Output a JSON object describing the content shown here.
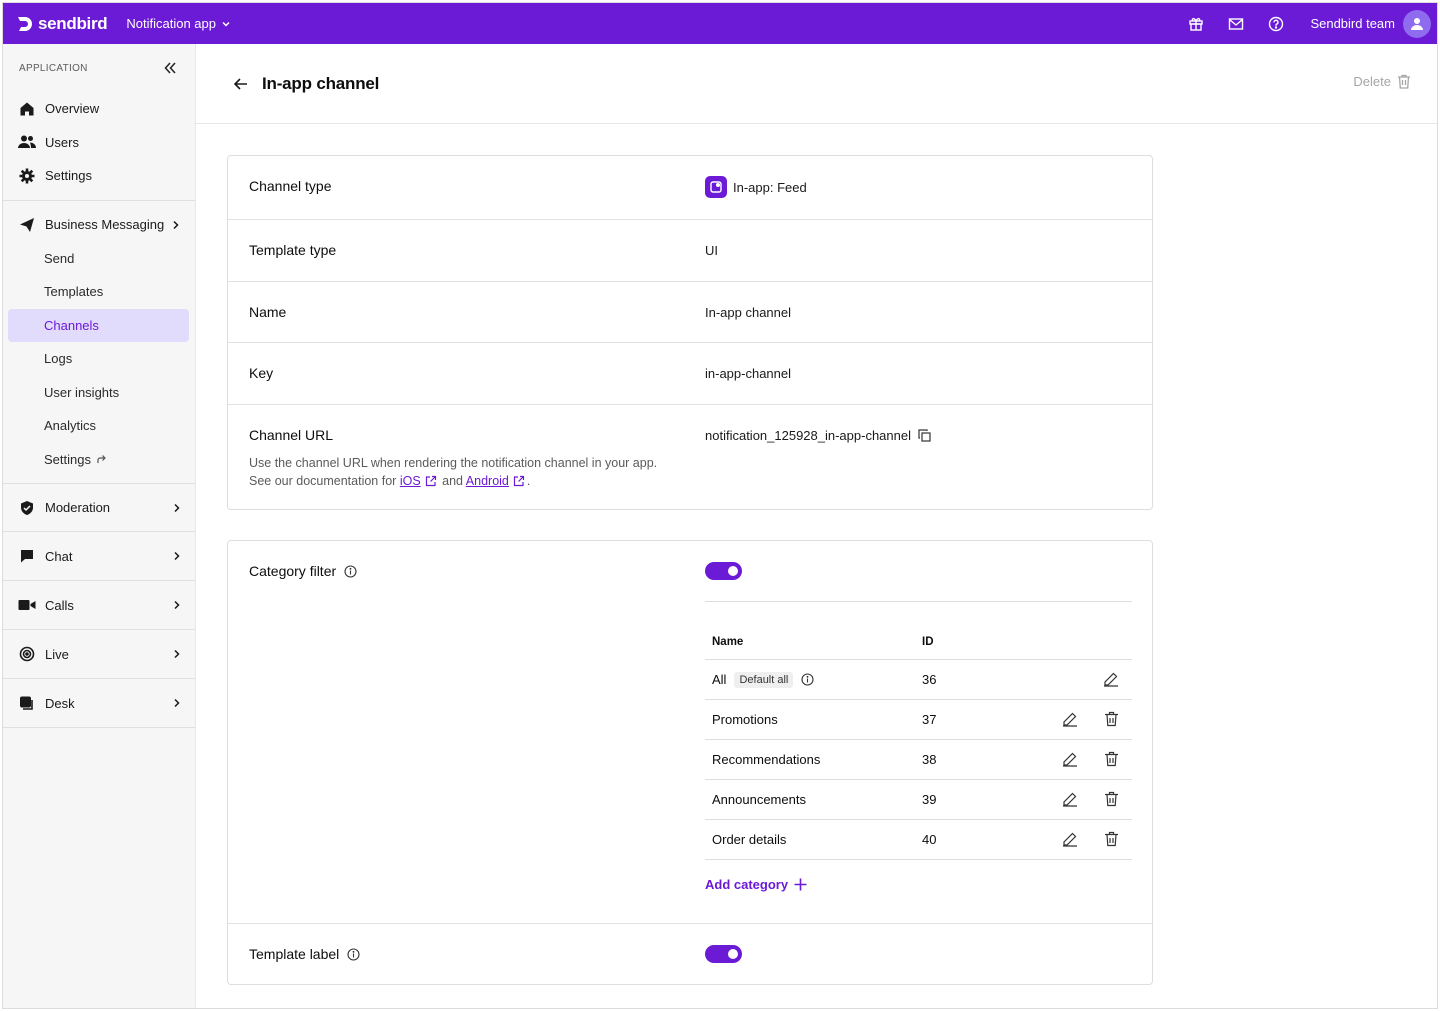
{
  "topbar": {
    "logo": "sendbird",
    "app_name": "Notification app",
    "team_name": "Sendbird team",
    "icons": [
      "gift-icon",
      "mail-icon",
      "help-icon",
      "user-icon"
    ]
  },
  "sidebar": {
    "section_label": "APPLICATION",
    "top_items": [
      {
        "label": "Overview",
        "icon": "home-icon"
      },
      {
        "label": "Users",
        "icon": "users-icon"
      },
      {
        "label": "Settings",
        "icon": "gear-icon"
      }
    ],
    "business_messaging": {
      "label": "Business Messaging",
      "icon": "send-icon",
      "sub_items": [
        "Send",
        "Templates",
        "Channels",
        "Logs",
        "User insights",
        "Analytics",
        "Settings"
      ],
      "active": "Channels"
    },
    "sections": [
      {
        "label": "Moderation",
        "icon": "shield-icon"
      },
      {
        "label": "Chat",
        "icon": "chat-icon"
      },
      {
        "label": "Calls",
        "icon": "video-icon"
      },
      {
        "label": "Live",
        "icon": "live-icon"
      },
      {
        "label": "Desk",
        "icon": "desk-icon"
      }
    ]
  },
  "page": {
    "title": "In-app channel",
    "delete_label": "Delete"
  },
  "details": {
    "channel_type": {
      "label": "Channel type",
      "value": "In-app: Feed"
    },
    "template_type": {
      "label": "Template type",
      "value": "UI"
    },
    "name": {
      "label": "Name",
      "value": "In-app channel"
    },
    "key": {
      "label": "Key",
      "value": "in-app-channel"
    },
    "channel_url": {
      "label": "Channel URL",
      "value": "notification_125928_in-app-channel",
      "desc_prefix": "Use the channel URL when rendering the notification channel in your app. See our documentation for",
      "ios_link": "iOS",
      "and": "and",
      "android_link": "Android",
      "period": "."
    }
  },
  "category_filter": {
    "label": "Category filter",
    "enabled": true,
    "columns": {
      "name": "Name",
      "id": "ID"
    },
    "rows": [
      {
        "name": "All",
        "id": "36",
        "badge": "Default all"
      },
      {
        "name": "Promotions",
        "id": "37"
      },
      {
        "name": "Recommendations",
        "id": "38"
      },
      {
        "name": "Announcements",
        "id": "39"
      },
      {
        "name": "Order details",
        "id": "40"
      }
    ],
    "add_label": "Add category"
  },
  "template_label": {
    "label": "Template label",
    "enabled": true
  },
  "colors": {
    "brand": "#6b1ad6",
    "active_bg": "#e1dcfb"
  }
}
